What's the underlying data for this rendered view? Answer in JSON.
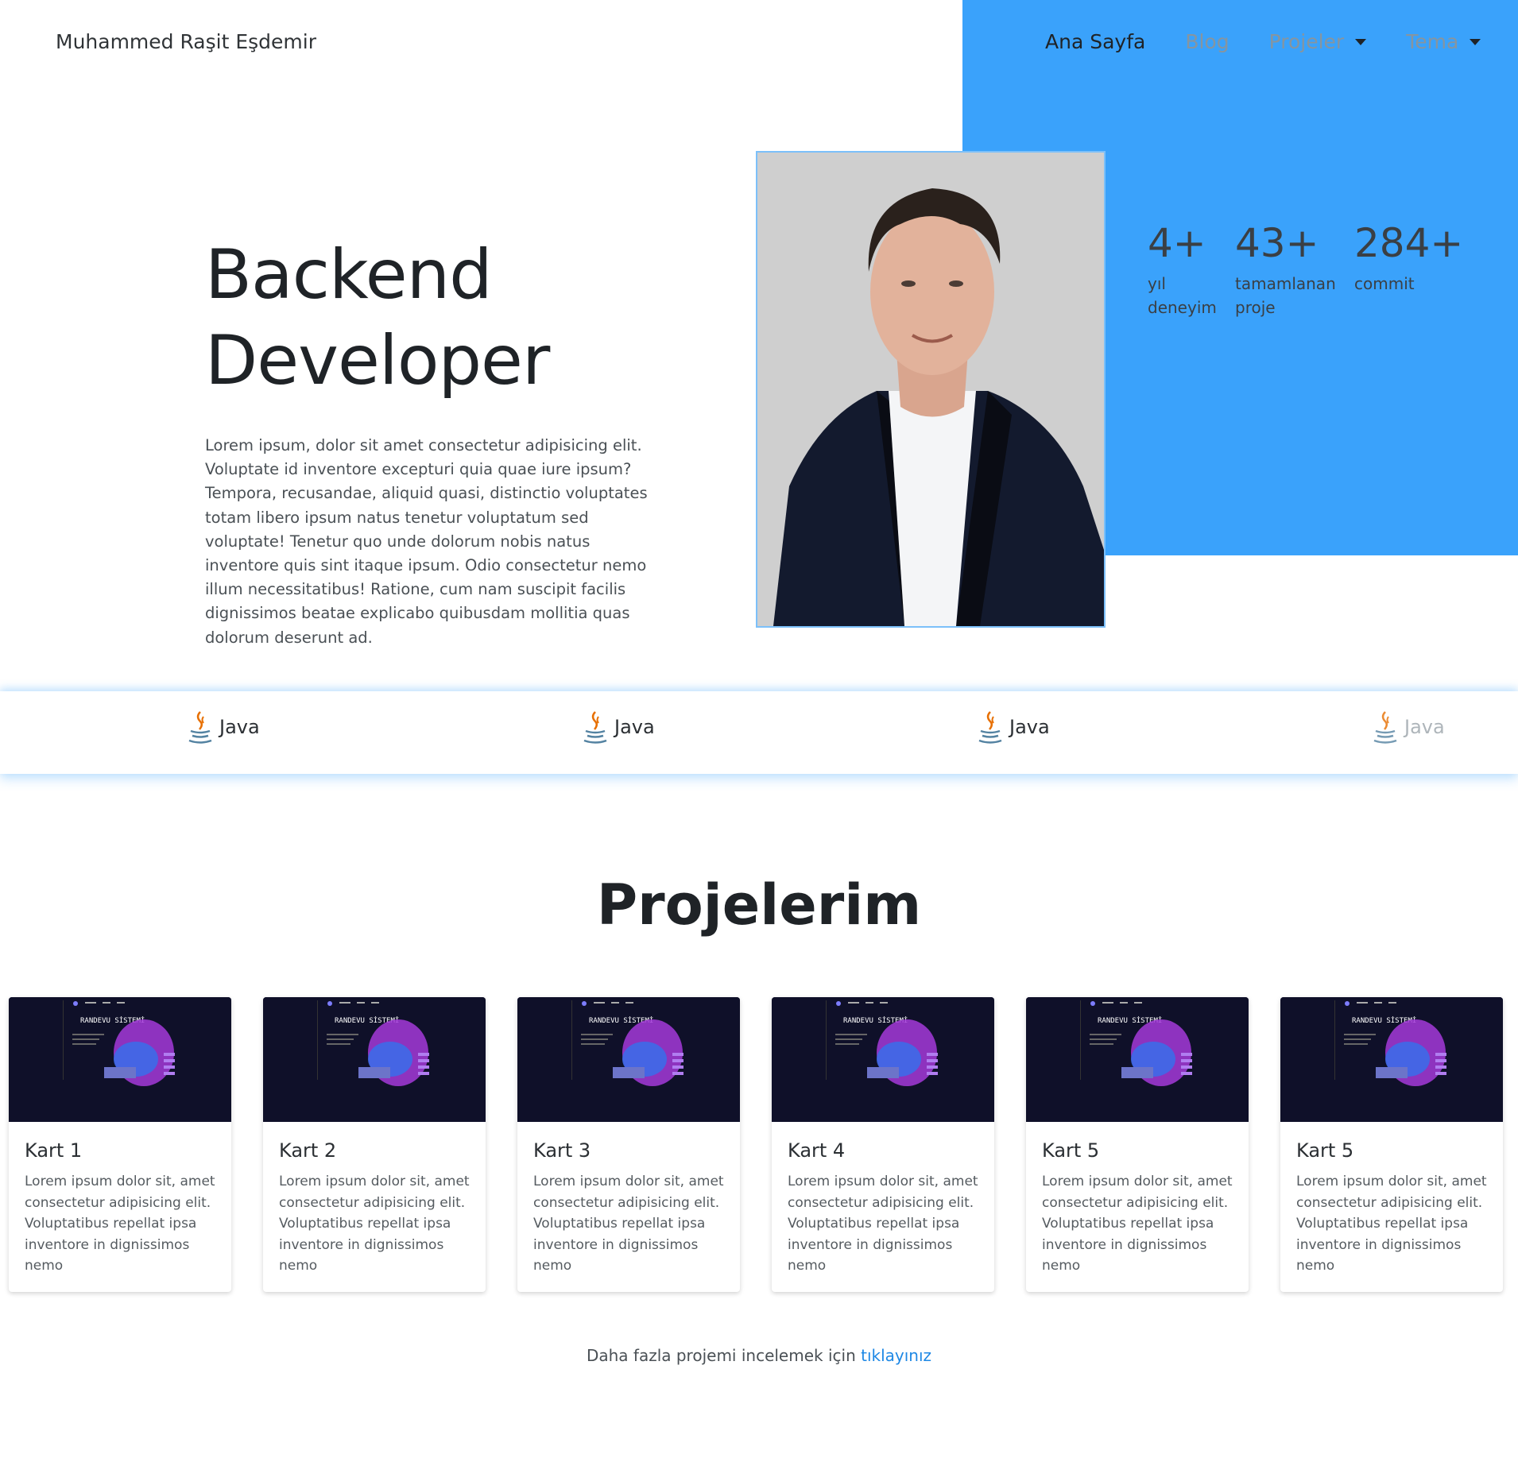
{
  "header": {
    "brand": "Muhammed Raşit Eşdemir",
    "nav": [
      {
        "label": "Ana Sayfa"
      },
      {
        "label": "Blog"
      },
      {
        "label": "Projeler"
      },
      {
        "label": "Tema"
      }
    ]
  },
  "hero": {
    "title_line1": "Backend",
    "title_line2": "Developer",
    "description": "Lorem ipsum, dolor sit amet consectetur adipisicing elit. Voluptate id inventore excepturi quia quae iure ipsum? Tempora, recusandae, aliquid quasi, distinctio voluptates totam libero ipsum natus tenetur voluptatum sed voluptate! Tenetur quo unde dolorum nobis natus inventore quis sint itaque ipsum. Odio consectetur nemo illum necessitatibus! Ratione, cum nam suscipit facilis dignissimos beatae explicabo quibusdam mollitia quas dolorum deserunt ad."
  },
  "stats": [
    {
      "value": "4+",
      "label": "yıl deneyim"
    },
    {
      "value": "43+",
      "label": "tamamlanan proje"
    },
    {
      "value": "284+",
      "label": "commit"
    }
  ],
  "tech": [
    {
      "label": "Java"
    },
    {
      "label": "Java"
    },
    {
      "label": "Java"
    },
    {
      "label": "Java"
    }
  ],
  "projects": {
    "title": "Projelerim",
    "card_image_text": "RANDEVU SİSTEMİ",
    "cards": [
      {
        "title": "Kart 1",
        "text": "Lorem ipsum dolor sit, amet consectetur adipisicing elit. Voluptatibus repellat ipsa inventore in dignissimos nemo"
      },
      {
        "title": "Kart 2",
        "text": "Lorem ipsum dolor sit, amet consectetur adipisicing elit. Voluptatibus repellat ipsa inventore in dignissimos nemo"
      },
      {
        "title": "Kart 3",
        "text": "Lorem ipsum dolor sit, amet consectetur adipisicing elit. Voluptatibus repellat ipsa inventore in dignissimos nemo"
      },
      {
        "title": "Kart 4",
        "text": "Lorem ipsum dolor sit, amet consectetur adipisicing elit. Voluptatibus repellat ipsa inventore in dignissimos nemo"
      },
      {
        "title": "Kart 5",
        "text": "Lorem ipsum dolor sit, amet consectetur adipisicing elit. Voluptatibus repellat ipsa inventore in dignissimos nemo"
      },
      {
        "title": "Kart 5",
        "text": "Lorem ipsum dolor sit, amet consectetur adipisicing elit. Voluptatibus repellat ipsa inventore in dignissimos nemo"
      }
    ],
    "more_text": "Daha fazla projemi incelemek için",
    "more_link": "tıklayınız"
  },
  "colors": {
    "accent_blue": "#3aa2fb",
    "link": "#1e88e5",
    "card_image_bg": "#0f1029"
  }
}
